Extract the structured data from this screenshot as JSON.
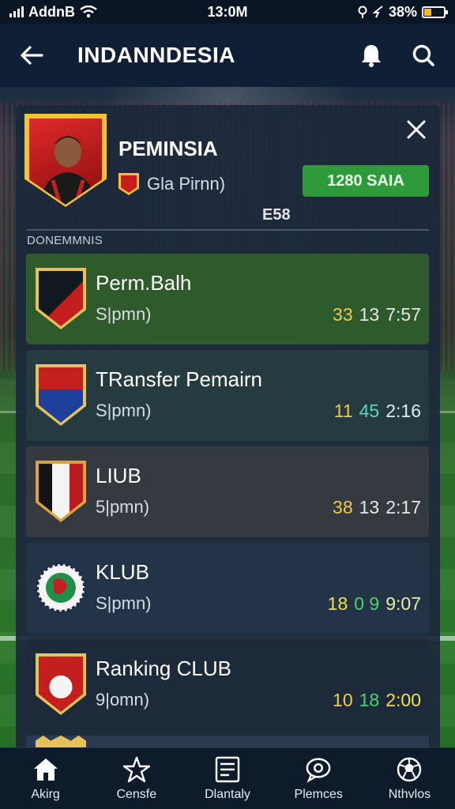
{
  "status": {
    "carrier": "AddnB",
    "time": "13:0M",
    "battery": "38%"
  },
  "appbar": {
    "title": "INDANNDESIA"
  },
  "profile": {
    "name": "PEMINSIA",
    "club": "Gla Pirnn)",
    "value_button": "1280 SAIA",
    "code": "E58"
  },
  "section_label": "DONEMMNIS",
  "rows": [
    {
      "title": "Perm.Balh",
      "subtitle": "S|pmn)",
      "stats": [
        "33",
        "13",
        "7:57"
      ],
      "stat_colors": [
        "#f2c94c",
        "#e8e8e8",
        "#e8e8e8"
      ],
      "bg": "#2e5a2c"
    },
    {
      "title": "TRansfer Pemairn",
      "subtitle": "S|pmn)",
      "stats": [
        "11",
        "45",
        "2:16"
      ],
      "stat_colors": [
        "#f2c94c",
        "#5fd3c4",
        "#d8f0ff"
      ],
      "bg": "#253b3f"
    },
    {
      "title": "LIUB",
      "subtitle": "5|pmn)",
      "stats": [
        "38",
        "13",
        "2:17"
      ],
      "stat_colors": [
        "#f2c94c",
        "#e8e8e8",
        "#e8e8e8"
      ],
      "bg": "#343a40"
    },
    {
      "title": "KLUB",
      "subtitle": "S|pmn)",
      "stats": [
        "18",
        "0 9",
        "9:07"
      ],
      "stat_colors": [
        "#f2e04c",
        "#4cd46a",
        "#e8f0a0"
      ],
      "bg": "#243448"
    },
    {
      "title": "Ranking CLUB",
      "subtitle": "9|omn)",
      "stats": [
        "10",
        "18",
        "2:00"
      ],
      "stat_colors": [
        "#f2c94c",
        "#4cd46a",
        "#f2e04c"
      ],
      "bg": "#1d2a3a"
    }
  ],
  "tabs": [
    {
      "label": "Akirg",
      "icon": "home-icon"
    },
    {
      "label": "Censfe",
      "icon": "star-icon"
    },
    {
      "label": "Dlantaly",
      "icon": "card-icon"
    },
    {
      "label": "Plemces",
      "icon": "chat-icon"
    },
    {
      "label": "Nthvlos",
      "icon": "ball-icon"
    }
  ]
}
